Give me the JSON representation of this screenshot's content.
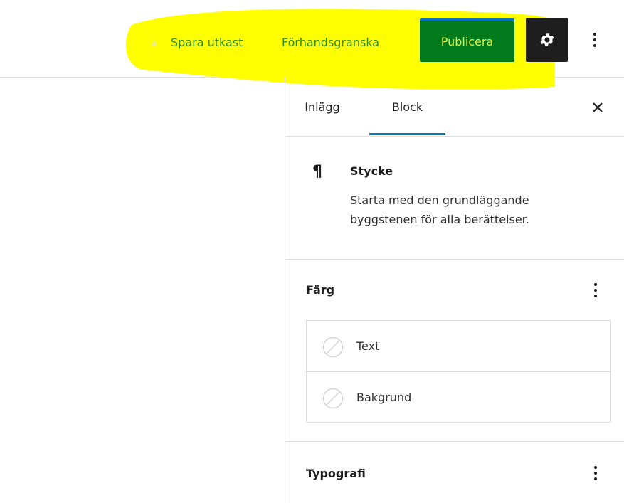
{
  "toolbar": {
    "save_draft": "Spara utkast",
    "preview": "Förhandsgranska",
    "publish": "Publicera",
    "settings_icon": "gear-icon",
    "more_icon": "vertical-ellipsis-icon"
  },
  "sidebar": {
    "tabs": [
      {
        "label": "Inlägg",
        "active": false
      },
      {
        "label": "Block",
        "active": true
      }
    ],
    "close_icon": "close-icon",
    "block": {
      "icon": "paragraph-icon",
      "title": "Stycke",
      "description": "Starta med den grundläggande byggstenen för alla berättelser."
    },
    "color_panel": {
      "title": "Färg",
      "options": [
        {
          "label": "Text",
          "icon": "no-color-swatch-icon"
        },
        {
          "label": "Bakgrund",
          "icon": "no-color-swatch-icon"
        }
      ]
    },
    "typography_panel": {
      "title": "Typografi"
    }
  },
  "colors": {
    "highlight": "#ffff00",
    "publish_bg": "#007a1a",
    "publish_text": "#e4ef3f",
    "link": "#2e8b18",
    "accent": "#007cba",
    "settings_bg": "#1e1e1e"
  }
}
